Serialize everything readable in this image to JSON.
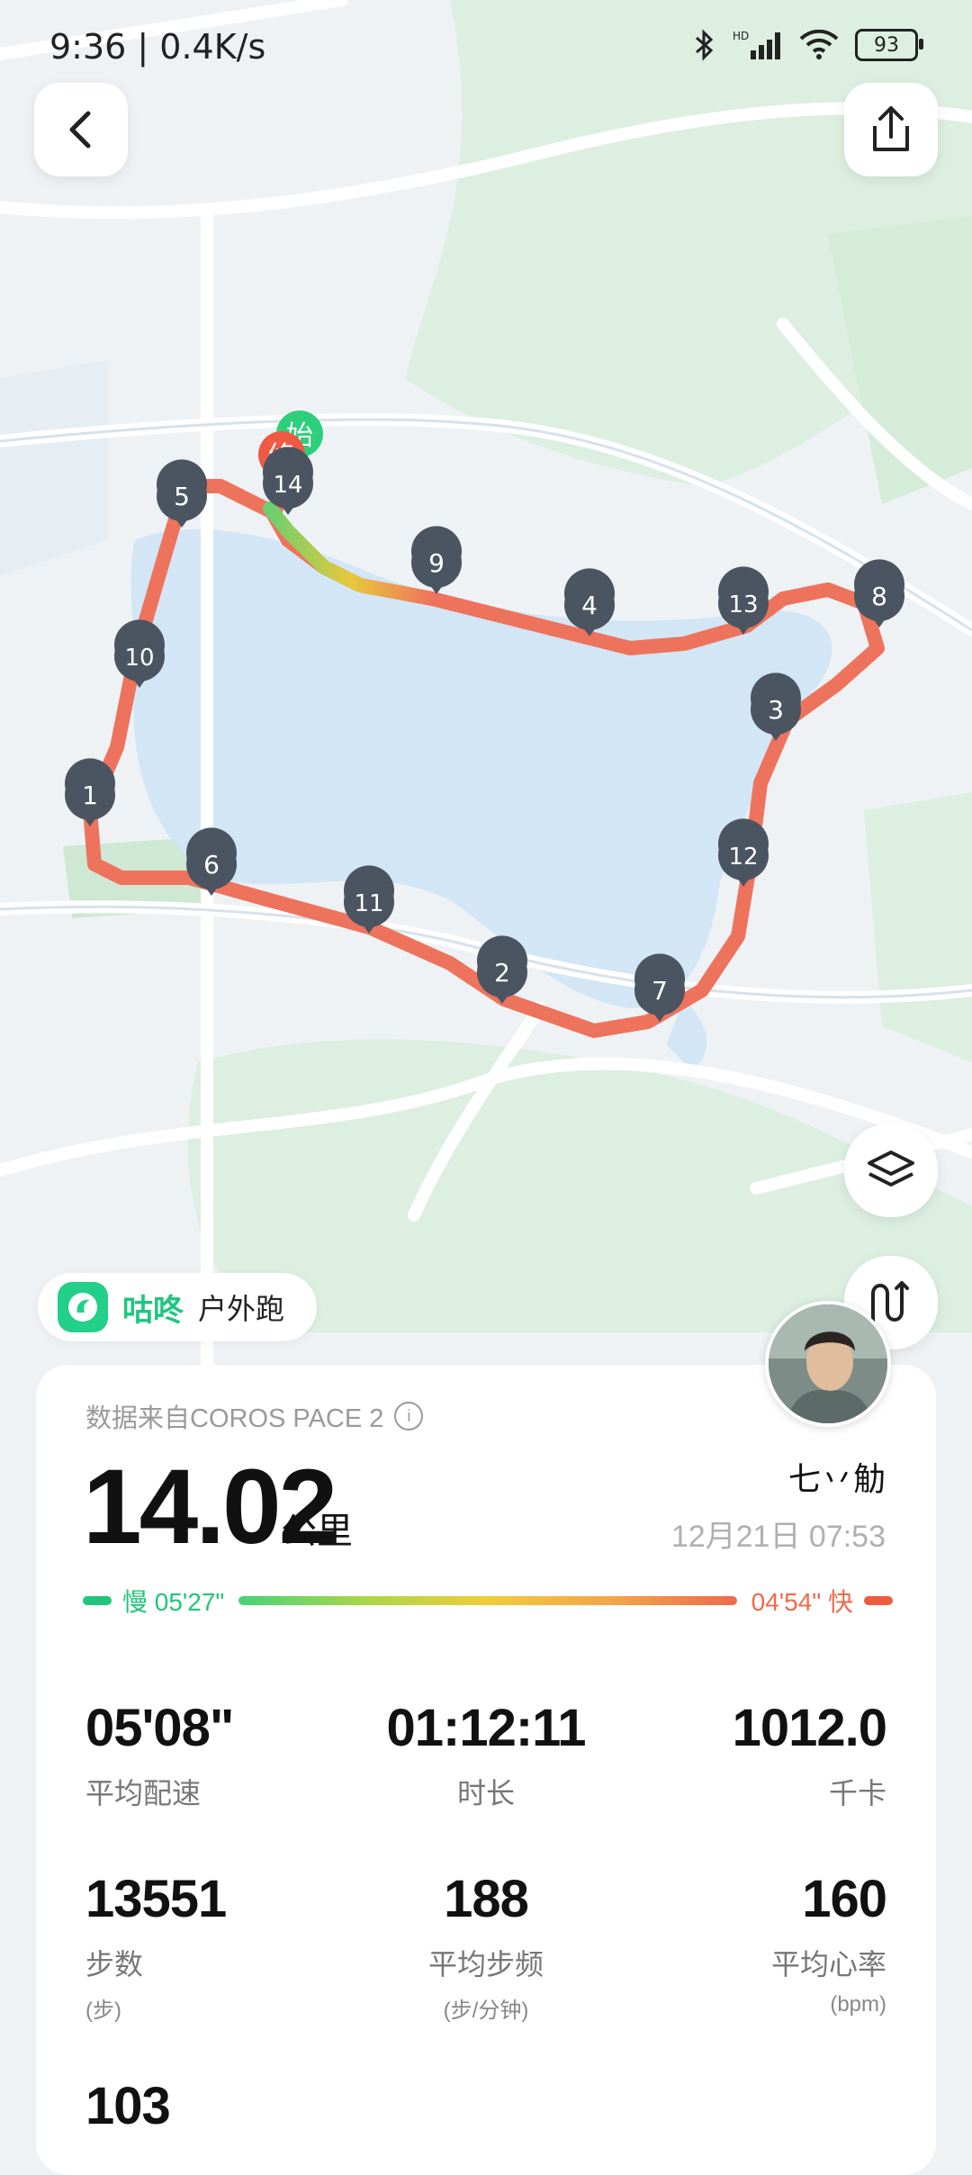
{
  "status_bar": {
    "time": "9:36 | 0.4K/s",
    "battery": "93"
  },
  "map": {
    "start_label": "始",
    "end_label": "终",
    "km_markers": [
      "1",
      "2",
      "3",
      "4",
      "5",
      "6",
      "7",
      "8",
      "9",
      "10",
      "11",
      "12",
      "13",
      "14"
    ]
  },
  "app_badge": {
    "app_name": "咕咚",
    "activity": "户外跑"
  },
  "summary": {
    "source": "数据来自COROS PACE 2",
    "distance": "14.02",
    "distance_unit": "公里",
    "username": "七丷觔",
    "datetime": "12月21日 07:53",
    "pace_slow": "慢 05'27\"",
    "pace_fast": "04'54\" 快"
  },
  "stats": [
    {
      "value": "05'08\"",
      "label": "平均配速",
      "sub": ""
    },
    {
      "value": "01:12:11",
      "label": "时长",
      "sub": ""
    },
    {
      "value": "1012.0",
      "label": "千卡",
      "sub": ""
    },
    {
      "value": "13551",
      "label": "步数",
      "sub": "(步)"
    },
    {
      "value": "188",
      "label": "平均步频",
      "sub": "(步/分钟)"
    },
    {
      "value": "160",
      "label": "平均心率",
      "sub": "(bpm)"
    },
    {
      "value": "103",
      "label": "",
      "sub": ""
    }
  ]
}
